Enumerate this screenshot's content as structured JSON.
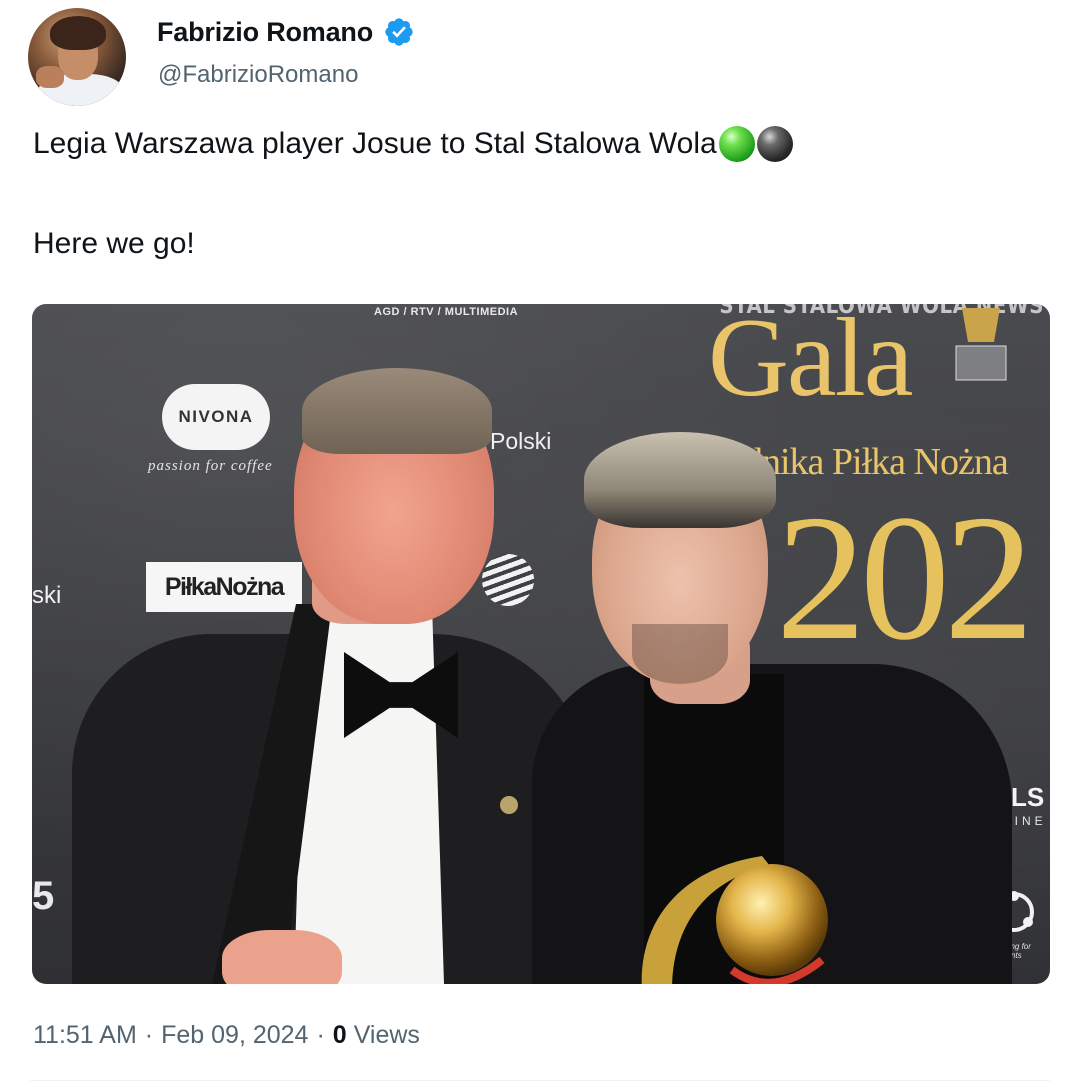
{
  "author": {
    "display_name": "Fabrizio Romano",
    "handle": "@FabrizioRomano",
    "verified": true,
    "verified_color": "#1d9bf0"
  },
  "tweet": {
    "line1": "Legia Warszawa player Josue to Stal Stalowa Wola",
    "emojis": [
      "green-circle",
      "black-circle"
    ],
    "line2": "Here we go!"
  },
  "photo": {
    "watermark": "STAL STALOWA WOLA NEWS",
    "top_sponsor": "AGD / RTV / MULTIMEDIA",
    "nivona": "NIVONA",
    "nivona_tagline": "passion for coffee",
    "polski": "Polski",
    "left_fragment": "ski",
    "pilka_nozna_logo": "PiłkaNożna",
    "gala_title": "Gala",
    "gala_subtitle": "odnika Piłka Nożna",
    "gala_year": "202",
    "bols": "BOLS",
    "marine": "MARINE",
    "events_text": "ything for events",
    "left_edge_char": "5",
    "accent_gold": "#e9c46a"
  },
  "meta": {
    "time": "11:51 AM",
    "separator": "·",
    "date": "Feb 09, 2024",
    "views_count": "0",
    "views_label": "Views"
  }
}
